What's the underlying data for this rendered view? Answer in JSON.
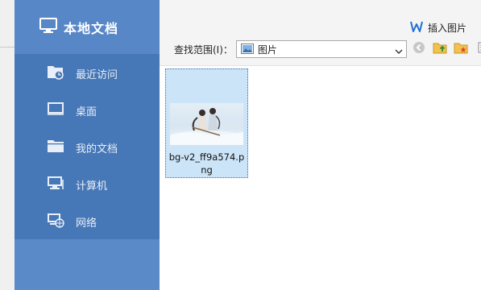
{
  "sidebar": {
    "title": "本地文档",
    "title_icon": "monitor-icon",
    "items": [
      {
        "label": "最近访问",
        "icon": "recent-folder-icon"
      },
      {
        "label": "桌面",
        "icon": "desktop-icon"
      },
      {
        "label": "我的文档",
        "icon": "folder-icon"
      },
      {
        "label": "计算机",
        "icon": "computer-icon"
      },
      {
        "label": "网络",
        "icon": "network-icon"
      }
    ]
  },
  "header": {
    "insert_label": "插入图片",
    "insert_icon": "wps-writer-icon",
    "range_label": "查找范围(I)：",
    "range_value": "图片",
    "range_icon": "picture-folder-icon"
  },
  "toolbar": {
    "icons": [
      "back-icon",
      "up-folder-icon",
      "new-folder-icon",
      "view-menu-icon"
    ]
  },
  "files": [
    {
      "name": "bg-v2_ff9a574.png",
      "selected": true
    }
  ],
  "colors": {
    "sidebar": "#4677b6",
    "sidebar_head": "#5887c7",
    "selection": "#cce4f7",
    "accent": "#1e6fd9"
  }
}
